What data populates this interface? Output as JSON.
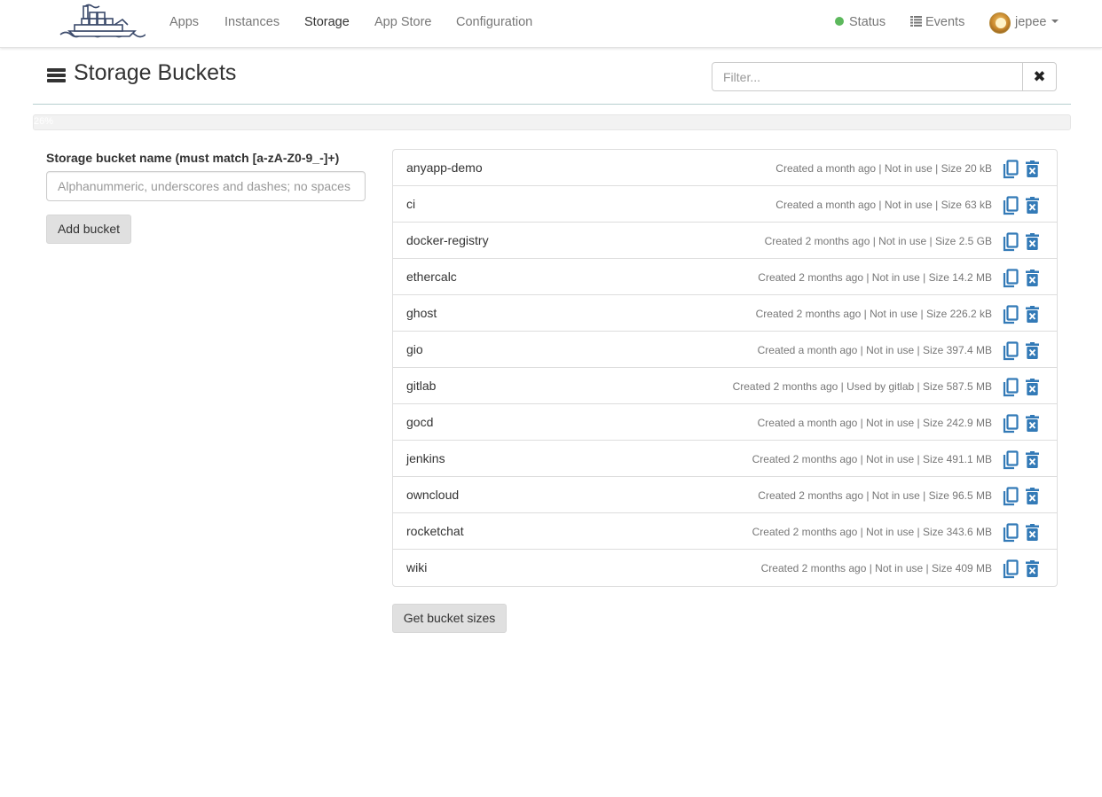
{
  "nav": {
    "logo_icon": "boat-logo-icon",
    "links": [
      "Apps",
      "Instances",
      "Storage",
      "App Store",
      "Configuration"
    ],
    "active": "Storage",
    "status_label": "Status",
    "status_color": "#5cb85c",
    "events_label": "Events",
    "user_name": "jepee"
  },
  "header": {
    "title": "Storage Buckets",
    "filter_placeholder": "Filter...",
    "progress_label": "26%"
  },
  "form": {
    "label": "Storage bucket name (must match [a-zA-Z0-9_-]+)",
    "placeholder": "Alphanummeric, underscores and dashes; no spaces",
    "add_button": "Add bucket"
  },
  "buckets": [
    {
      "name": "anyapp-demo",
      "meta": "Created a month ago | Not in use | Size 20 kB"
    },
    {
      "name": "ci",
      "meta": "Created a month ago | Not in use | Size 63 kB"
    },
    {
      "name": "docker-registry",
      "meta": "Created 2 months ago | Not in use | Size 2.5 GB"
    },
    {
      "name": "ethercalc",
      "meta": "Created 2 months ago | Not in use | Size 14.2 MB"
    },
    {
      "name": "ghost",
      "meta": "Created 2 months ago | Not in use | Size 226.2 kB"
    },
    {
      "name": "gio",
      "meta": "Created a month ago | Not in use | Size 397.4 MB"
    },
    {
      "name": "gitlab",
      "meta": "Created 2 months ago | Used by gitlab | Size 587.5 MB"
    },
    {
      "name": "gocd",
      "meta": "Created a month ago | Not in use | Size 242.9 MB"
    },
    {
      "name": "jenkins",
      "meta": "Created 2 months ago | Not in use | Size 491.1 MB"
    },
    {
      "name": "owncloud",
      "meta": "Created 2 months ago | Not in use | Size 96.5 MB"
    },
    {
      "name": "rocketchat",
      "meta": "Created 2 months ago | Not in use | Size 343.6 MB"
    },
    {
      "name": "wiki",
      "meta": "Created 2 months ago | Not in use | Size 409 MB"
    }
  ],
  "get_sizes_button": "Get bucket sizes",
  "colors": {
    "action_blue": "#337ab7",
    "status_green": "#5cb85c"
  }
}
